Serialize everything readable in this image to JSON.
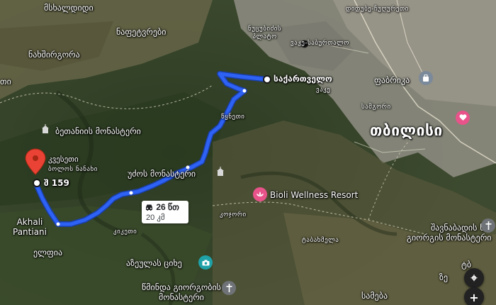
{
  "labels": {
    "msxaldidi": "მსხალდიდი",
    "naphetvrebi": "ნაფეტვრები",
    "nakhshirgora": "ნახშირგორა",
    "ti_left": "თი",
    "didube_chughureti": "დიდუბე-ჩუღურეთი",
    "nutsubidze_plato": "ნუცუბიძის\nპლატო",
    "vake_saburtalo": "ვაკე-საბურთალო",
    "sakartvelo": "საქართველო",
    "vake": "ვაკე",
    "fabrika": "ფაბრიკა",
    "samgori": "სამგორი",
    "tbilisi": "თბილისი",
    "betania": "ბეთანიის მონასტერი",
    "kvesheti": "კვესეთი",
    "kvesheti_sub": "ბოლოს ნანახი",
    "sh159": "შ 159",
    "tskneti": "წყნეთი",
    "udzos": "უძოს მონასტერი",
    "bioli": "Bioli Wellness Resort",
    "kojori": "კოჯორი",
    "akhali_pantiani": "Akhali\nPantiani",
    "kiketi": "კიკეთი",
    "tabakhmela": "ტაბახმელა",
    "shavnabada": "შავნაბადის წმ.\nგიორგის მონასტერი",
    "elphia": "ელფია",
    "azeulas": "აზეულას ციხე",
    "tsminda_giorgi": "წმინდა გიორგობის\nმონასტერი",
    "samteba": "სამება",
    "tbi_edge": "ტბ",
    "ze_edge": "ზე"
  },
  "route": {
    "duration": "26 წთ",
    "distance": "20 კმ",
    "color": "#2e62f5"
  },
  "icons": {
    "destination": "red-map-pin",
    "fabrika": "shopping-bag",
    "tbilisi": "heart",
    "bioli": "spa-flower",
    "azeulas": "camera",
    "monastery": "church-cross",
    "car": "car"
  },
  "controls": {
    "zoom_in": "+",
    "locate": "⌖"
  }
}
